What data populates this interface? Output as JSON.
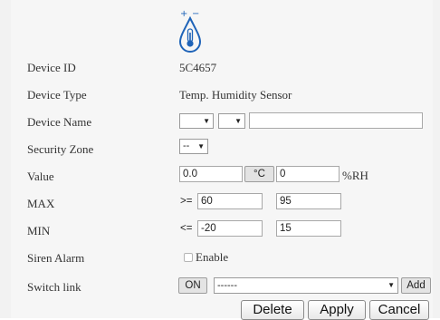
{
  "device": {
    "icon": "temperature-humidity-drop-icon",
    "icon_signs": "+ | −"
  },
  "fields": {
    "device_id": {
      "label": "Device ID",
      "value": "5C4657"
    },
    "device_type": {
      "label": "Device Type",
      "value": "Temp. Humidity Sensor"
    },
    "device_name": {
      "label": "Device Name",
      "select1": "",
      "select2": "",
      "text": ""
    },
    "security_zone": {
      "label": "Security Zone",
      "selected": "--"
    },
    "value": {
      "label": "Value",
      "temp": "0.0",
      "unit_button": "°C",
      "humidity": "0",
      "humidity_unit": "%RH"
    },
    "max": {
      "label": "MAX",
      "op": ">=",
      "temp": "60",
      "humidity": "95"
    },
    "min": {
      "label": "MIN",
      "op": "<=",
      "temp": "-20",
      "humidity": "15"
    },
    "siren_alarm": {
      "label": "Siren Alarm",
      "checkbox_label": "Enable",
      "checked": false
    },
    "switch_link": {
      "label": "Switch link",
      "on_button": "ON",
      "selected": "------",
      "add_button": "Add"
    }
  },
  "actions": {
    "delete": "Delete",
    "apply": "Apply",
    "cancel": "Cancel"
  },
  "colors": {
    "icon_blue": "#1e63b8",
    "panel_bg": "#f6f6f6"
  }
}
